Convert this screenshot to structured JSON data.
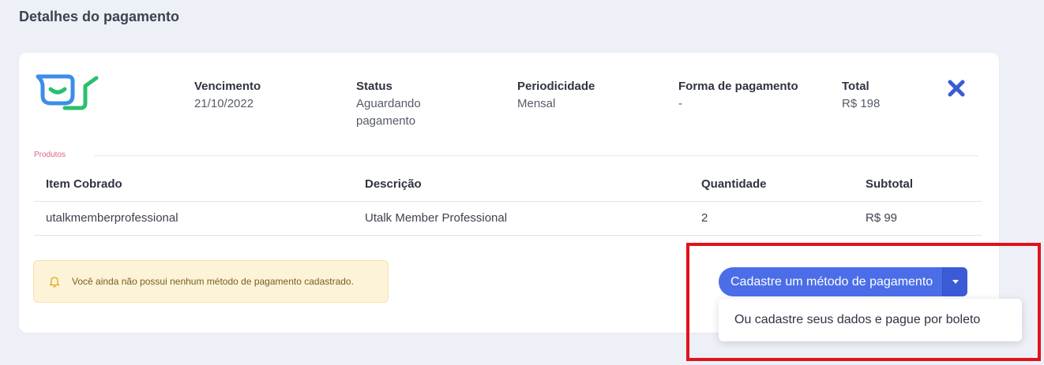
{
  "page": {
    "title": "Detalhes do pagamento"
  },
  "invoice": {
    "due": {
      "label": "Vencimento",
      "value": "21/10/2022"
    },
    "status": {
      "label": "Status",
      "value_line1": "Aguardando",
      "value_line2": "pagamento"
    },
    "period": {
      "label": "Periodicidade",
      "value": "Mensal"
    },
    "payment_method": {
      "label": "Forma de pagamento",
      "value": "-"
    },
    "total": {
      "label": "Total",
      "value": "R$ 198"
    },
    "close_icon": "close-x-icon"
  },
  "products": {
    "legend": "Produtos",
    "columns": [
      "Item Cobrado",
      "Descrição",
      "Quantidade",
      "Subtotal"
    ],
    "rows": [
      [
        "utalkmemberprofessional",
        "Utalk Member Professional",
        "2",
        "R$ 99"
      ]
    ]
  },
  "alert": {
    "icon": "bell-icon",
    "text": "Você ainda não possui nenhum método de pagamento cadastrado."
  },
  "actions": {
    "primary_label": "Cadastre um método de pagamento",
    "caret_icon": "chevron-down-icon",
    "dropdown_items": [
      "Ou cadastre seus dados e pague por boleto"
    ]
  },
  "colors": {
    "accent": "#4b6ee8",
    "close": "#3b5bd6",
    "legend": "#e0607e",
    "alert_bg": "#fdf3d8",
    "highlight": "#e0121b"
  }
}
